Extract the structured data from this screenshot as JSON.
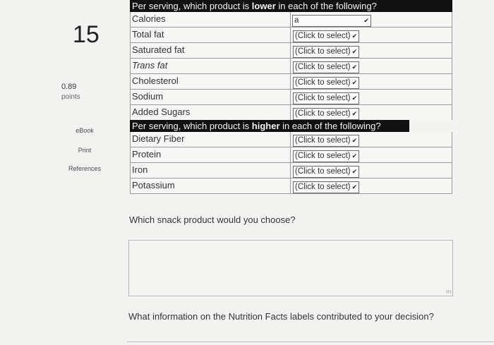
{
  "question": {
    "number": "15",
    "points_value": "0.89",
    "points_label": "points"
  },
  "sidebar": {
    "links": [
      "eBook",
      "Print",
      "References"
    ]
  },
  "table": {
    "header_lower": {
      "pre": "Per serving, which product is ",
      "bold": "lower",
      "post": " in each of the following?"
    },
    "header_higher": {
      "pre": "Per serving, which product is ",
      "bold": "higher",
      "post": " in each of the following?"
    },
    "lower_rows": [
      {
        "label": "Calories",
        "value": "a"
      },
      {
        "label": "Total fat",
        "value": "(Click to select)"
      },
      {
        "label": "Saturated fat",
        "value": "(Click to select)"
      },
      {
        "label": "Trans fat",
        "value": "(Click to select)"
      },
      {
        "label": "Cholesterol",
        "value": "(Click to select)"
      },
      {
        "label": "Sodium",
        "value": "(Click to select)"
      },
      {
        "label": "Added Sugars",
        "value": "(Click to select)"
      }
    ],
    "higher_rows": [
      {
        "label": "Dietary Fiber",
        "value": "(Click to select)"
      },
      {
        "label": "Protein",
        "value": "(Click to select)"
      },
      {
        "label": "Iron",
        "value": "(Click to select)"
      },
      {
        "label": "Potassium",
        "value": "(Click to select)"
      }
    ]
  },
  "prompts": {
    "snack_choice": "Which snack product would you choose?",
    "info_decision": "What information on the Nutrition Facts labels contributed to your decision?"
  }
}
